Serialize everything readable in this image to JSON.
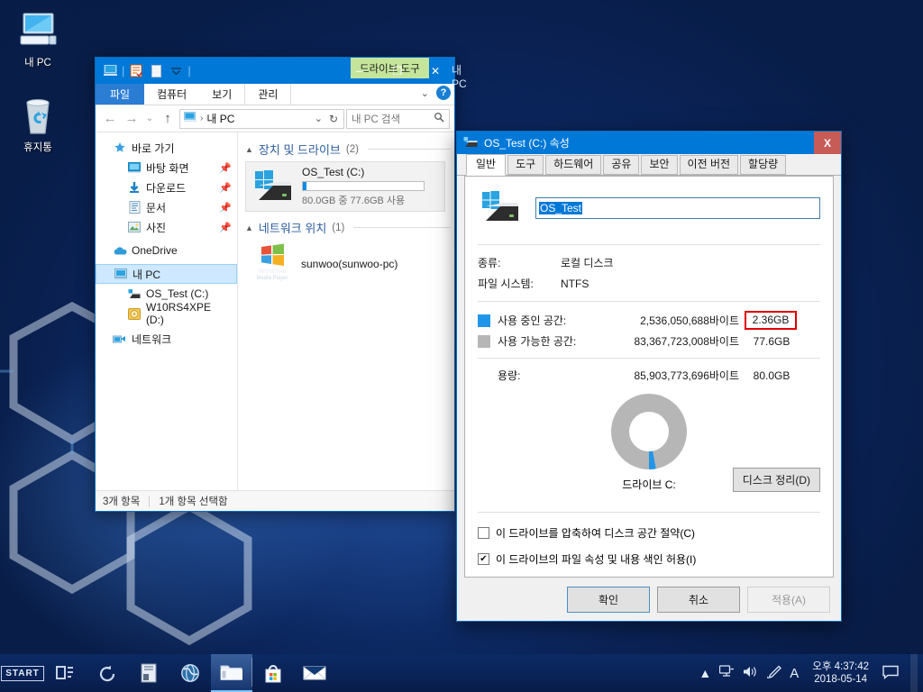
{
  "desktop": {
    "icons": [
      {
        "name": "내 PC",
        "icon": "this-pc-icon"
      },
      {
        "name": "휴지통",
        "icon": "recycle-bin-icon"
      }
    ]
  },
  "explorer": {
    "title": "내 PC",
    "contextual_tab": "드라이브 도구",
    "quick_access_toolbar": [
      "this-pc-icon",
      "properties-icon",
      "new-folder-icon",
      "customize-chevron-icon"
    ],
    "window_buttons": {
      "minimize": "─",
      "maximize": "❐",
      "close": "✕"
    },
    "ribbon_tabs": [
      {
        "label": "파일",
        "active": true,
        "type": "file"
      },
      {
        "label": "컴퓨터",
        "active": false,
        "type": "normal"
      },
      {
        "label": "보기",
        "active": false,
        "type": "normal"
      },
      {
        "label": "관리",
        "active": false,
        "type": "contextual"
      }
    ],
    "address": {
      "back": "←",
      "forward": "→",
      "recent": "⌄",
      "up": "↑",
      "crumb_icon": "this-pc-icon",
      "crumb": "내 PC",
      "separator": "›",
      "dropdown": "⌄",
      "refresh": "↻"
    },
    "search": {
      "placeholder": "내 PC 검색",
      "icon": "search-icon"
    },
    "nav_pane": [
      {
        "label": "바로 가기",
        "icon": "quick-access-star-icon",
        "level": 0,
        "pinned": false,
        "selected": false
      },
      {
        "label": "바탕 화면",
        "icon": "desktop-icon",
        "level": 1,
        "pinned": true,
        "selected": false
      },
      {
        "label": "다운로드",
        "icon": "downloads-icon",
        "level": 1,
        "pinned": true,
        "selected": false
      },
      {
        "label": "문서",
        "icon": "documents-icon",
        "level": 1,
        "pinned": true,
        "selected": false
      },
      {
        "label": "사진",
        "icon": "pictures-icon",
        "level": 1,
        "pinned": true,
        "selected": false
      },
      {
        "label": "OneDrive",
        "icon": "onedrive-cloud-icon",
        "level": 0,
        "pinned": false,
        "selected": false
      },
      {
        "label": "내 PC",
        "icon": "this-pc-icon",
        "level": 0,
        "pinned": false,
        "selected": true
      },
      {
        "label": "OS_Test (C:)",
        "icon": "hard-drive-icon",
        "level": 1,
        "pinned": false,
        "selected": false
      },
      {
        "label": "W10RS4XPE (D:)",
        "icon": "optical-drive-icon",
        "level": 1,
        "pinned": false,
        "selected": false
      },
      {
        "label": "네트워크",
        "icon": "network-icon",
        "level": 0,
        "pinned": false,
        "selected": false
      }
    ],
    "groups": [
      {
        "title": "장치 및 드라이브",
        "count": "(2)",
        "items": [
          {
            "name": "OS_Test (C:)",
            "icon": "windows-drive-icon",
            "usage_text": "80.0GB 중 77.6GB 사용",
            "bar_percent": 3,
            "selected": true
          }
        ]
      },
      {
        "title": "네트워크 위치",
        "count": "(1)",
        "items": [
          {
            "name": "sunwoo(sunwoo-pc)",
            "icon": "windows-media-player-icon",
            "usage_text": "",
            "bar_percent": 0,
            "selected": false
          }
        ]
      }
    ],
    "status": {
      "items_total": "3개 항목",
      "items_selected": "1개 항목 선택함"
    }
  },
  "properties_dialog": {
    "title": "OS_Test (C:) 속성",
    "title_icon": "hard-drive-icon",
    "close_label": "X",
    "tabs": [
      {
        "label": "일반",
        "active": true
      },
      {
        "label": "도구",
        "active": false
      },
      {
        "label": "하드웨어",
        "active": false
      },
      {
        "label": "공유",
        "active": false
      },
      {
        "label": "보안",
        "active": false
      },
      {
        "label": "이전 버전",
        "active": false
      },
      {
        "label": "할당량",
        "active": false
      }
    ],
    "volume": {
      "icon": "windows-drive-icon",
      "value": "OS_Test",
      "selected": true
    },
    "info": [
      {
        "key": "종류:",
        "value": "로컬 디스크"
      },
      {
        "key": "파일 시스템:",
        "value": "NTFS"
      }
    ],
    "sizes": [
      {
        "label": "사용 중인 공간:",
        "bytes": "2,536,050,688바이트",
        "human": "2.36GB",
        "color": "#2196e8",
        "highlighted": true
      },
      {
        "label": "사용 가능한 공간:",
        "bytes": "83,367,723,008바이트",
        "human": "77.6GB",
        "color": "#b6b6b6",
        "highlighted": false
      }
    ],
    "capacity": {
      "label": "용량:",
      "bytes": "85,903,773,696바이트",
      "human": "80.0GB"
    },
    "chart": {
      "used_percent": 2.95,
      "used_color": "#2196e8",
      "free_color": "#b6b6b6"
    },
    "drive_caption": "드라이브 C:",
    "cleanup_button": "디스크 정리(D)",
    "checkboxes": [
      {
        "label": "이 드라이브를 압축하여 디스크 공간 절약(C)",
        "checked": false
      },
      {
        "label": "이 드라이브의 파일 속성 및 내용 색인 허용(I)",
        "checked": true
      }
    ],
    "footer_buttons": [
      {
        "label": "확인",
        "style": "primary",
        "enabled": true
      },
      {
        "label": "취소",
        "style": "normal",
        "enabled": true
      },
      {
        "label": "적용(A)",
        "style": "disabled",
        "enabled": false
      }
    ],
    "highlight_color": "#e00000"
  },
  "taskbar": {
    "start_label": "START",
    "buttons": [
      {
        "name": "task-view-icon",
        "active": false
      },
      {
        "name": "history-restore-icon",
        "active": false
      },
      {
        "name": "notepad-icon",
        "active": false
      },
      {
        "name": "browser-globe-icon",
        "active": false
      },
      {
        "name": "file-explorer-icon",
        "active": true
      },
      {
        "name": "microsoft-store-icon",
        "active": false
      },
      {
        "name": "mail-icon",
        "active": false
      }
    ],
    "tray": {
      "show_hidden": "▲",
      "icons": [
        "network-icon",
        "volume-icon",
        "pen-icon",
        "ime-icon"
      ],
      "ime_label": "A",
      "time": "오후 4:37:42",
      "date": "2018-05-14",
      "action_center": "action-center-icon"
    }
  }
}
